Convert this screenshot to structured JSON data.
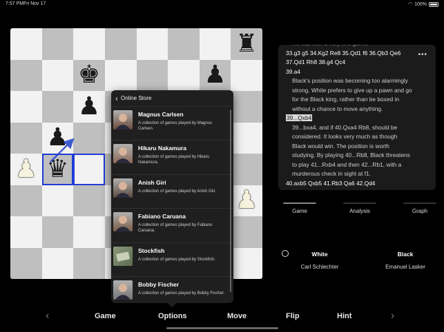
{
  "status_bar": {
    "time": "7:57 PM",
    "date": "Fri Nov 17",
    "battery": "100%"
  },
  "board": {
    "squares": [
      [
        "",
        "",
        "",
        "",
        "",
        "",
        "",
        "bR"
      ],
      [
        "",
        "",
        "bK",
        "",
        "",
        "",
        "bP",
        ""
      ],
      [
        "",
        "",
        "bP",
        "",
        "",
        "",
        "",
        ""
      ],
      [
        "",
        "bP",
        "",
        "",
        "",
        "",
        "",
        ""
      ],
      [
        "wP",
        "bQ",
        "",
        "",
        "",
        "",
        "",
        ""
      ],
      [
        "",
        "",
        "",
        "",
        "",
        "",
        "",
        "wP"
      ],
      [
        "",
        "",
        "",
        "",
        "",
        "",
        "",
        ""
      ],
      [
        "",
        "",
        "",
        "",
        "",
        "",
        "",
        ""
      ]
    ],
    "selected_squares": [
      "b4",
      "c4"
    ],
    "last_move": {
      "from": "b4",
      "to": "b5"
    }
  },
  "online_store": {
    "title": "Online Store",
    "items": [
      {
        "name": "Magnus Carlsen",
        "desc": "A collection of games played by Magnus Carlsen.",
        "avatar": "person-avatar"
      },
      {
        "name": "Hikaru Nakamura",
        "desc": "A collection of games played by Hikaru Nakamura.",
        "avatar": "person-avatar"
      },
      {
        "name": "Anish Giri",
        "desc": "A collection of games played by Anish Giri.",
        "avatar": "person-avatar"
      },
      {
        "name": "Fabiano Caruana",
        "desc": "A collection of games played by Fabiano Caruana.",
        "avatar": "person-avatar"
      },
      {
        "name": "Stockfish",
        "desc": "A collection of games played by Stockfish.",
        "avatar": "engine-avatar"
      },
      {
        "name": "Bobby Fischer",
        "desc": "A collection of games played by Bobby Fischer.",
        "avatar": "person-avatar"
      }
    ]
  },
  "notation": {
    "lines": [
      {
        "kind": "dim",
        "text": "He has now a very fine game."
      },
      {
        "kind": "move",
        "text": "33.g3 g5 34.Kg2 Re8 35.Qd1 f6 36.Qb3 Qe6"
      },
      {
        "kind": "move",
        "text": "37.Qd1 Rh8 38.g4 Qc4"
      },
      {
        "kind": "move",
        "text": "39.a4"
      },
      {
        "kind": "comment",
        "text": "Black's position was becoming too alarmingly"
      },
      {
        "kind": "comment",
        "text": "strong. White prefers to give up a pawn and go"
      },
      {
        "kind": "comment",
        "text": "for the Black king, rather than be boxed in"
      },
      {
        "kind": "comment",
        "text": "without a chance to move anything."
      },
      {
        "kind": "current",
        "text": "39...Qxb4"
      },
      {
        "kind": "comment",
        "text": "39...bxa4, and if 40.Qxa4 Rb8, should be"
      },
      {
        "kind": "comment",
        "text": "considered. It looks very much as though"
      },
      {
        "kind": "comment",
        "text": "Black would win. The position is worth"
      },
      {
        "kind": "comment",
        "text": "studying. By playing 40...Rb8, Black threatens"
      },
      {
        "kind": "comment",
        "text": "to play 41...Rxb4 and then 42...Rb1, with a"
      },
      {
        "kind": "comment",
        "text": "murderous check in sight at f1."
      },
      {
        "kind": "move",
        "text": "40.axb5 Qxb5 41.Rb3 Qa6 42.Qd4"
      }
    ]
  },
  "tabs": [
    "Game",
    "Analysis",
    "Graph"
  ],
  "active_tab": "Game",
  "players": {
    "white_label": "White",
    "white_name": "Carl Schlechter",
    "black_label": "Black",
    "black_name": "Emanuel Lasker"
  },
  "toolbar": {
    "game": "Game",
    "options": "Options",
    "move": "Move",
    "flip": "Flip",
    "hint": "Hint"
  },
  "colors": {
    "selection": "#1f3bd6",
    "light_square": "#f2f2f2",
    "dark_square": "#bfbfbf",
    "popover_bg": "#1f1f1f"
  }
}
